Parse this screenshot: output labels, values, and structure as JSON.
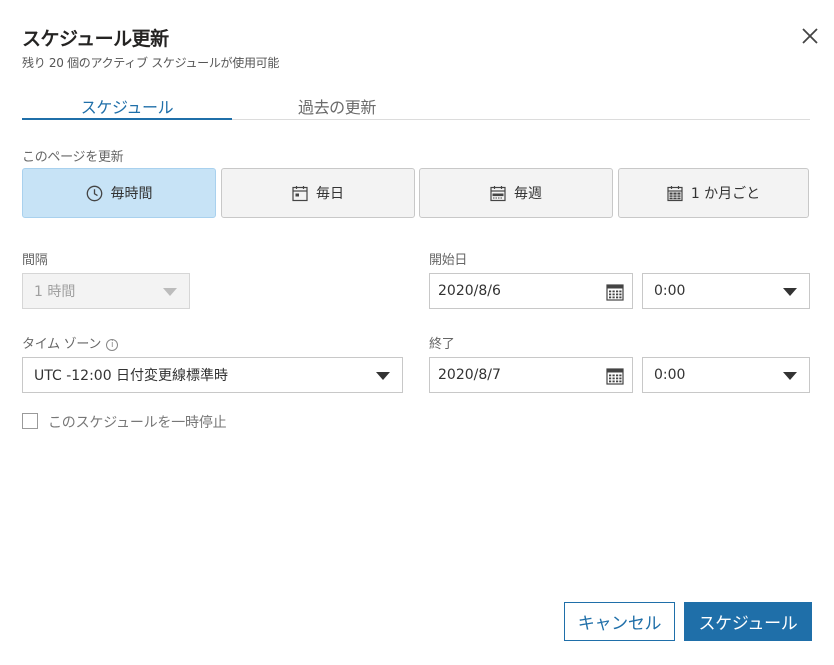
{
  "dialog": {
    "title": "スケジュール更新",
    "subtitle": "残り 20 個のアクティブ スケジュールが使用可能"
  },
  "tabs": [
    {
      "label": "スケジュール",
      "active": true
    },
    {
      "label": "過去の更新",
      "active": false
    }
  ],
  "refresh": {
    "label": "このページを更新",
    "options": [
      {
        "label": "毎時間",
        "icon": "clock-icon",
        "selected": true
      },
      {
        "label": "毎日",
        "icon": "calendar-day-icon",
        "selected": false
      },
      {
        "label": "毎週",
        "icon": "calendar-week-icon",
        "selected": false
      },
      {
        "label": "1 か月ごと",
        "icon": "calendar-month-icon",
        "selected": false
      }
    ]
  },
  "interval": {
    "label": "間隔",
    "value": "1 時間",
    "disabled": true
  },
  "start": {
    "label": "開始日",
    "date": "2020/8/6",
    "time": "0:00"
  },
  "end": {
    "label": "終了",
    "date": "2020/8/7",
    "time": "0:00"
  },
  "timezone": {
    "label": "タイム ゾーン",
    "value": "UTC -12:00 日付変更線標準時",
    "info_icon": "i"
  },
  "pause": {
    "label": "このスケジュールを一時停止",
    "checked": false
  },
  "buttons": {
    "cancel": "キャンセル",
    "schedule": "スケジュール"
  },
  "colors": {
    "accent": "#1f6fa9",
    "selected_bg": "#c7e3f6"
  }
}
